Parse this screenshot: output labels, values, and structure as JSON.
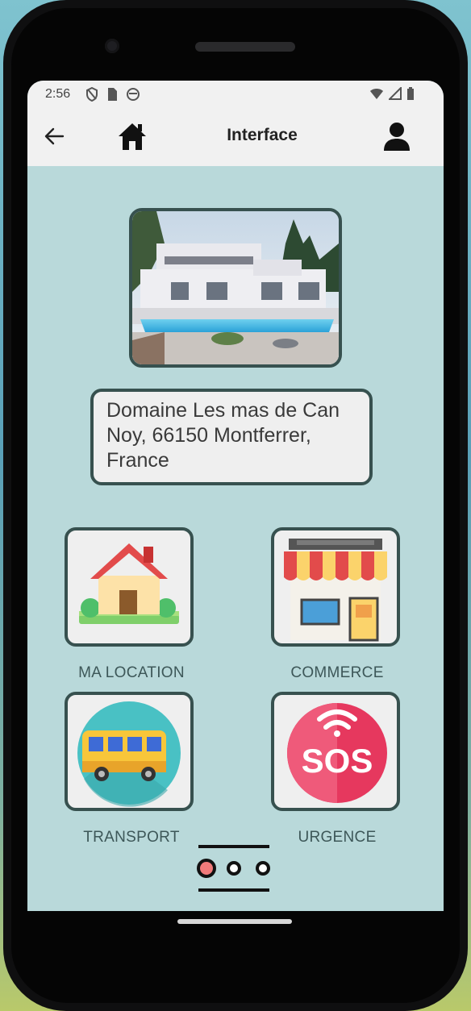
{
  "status_bar": {
    "time": "2:56"
  },
  "app_bar": {
    "title": "Interface"
  },
  "address": "Domaine Les mas de Can Noy, 66150 Montferrer, France",
  "tiles": [
    {
      "label": "MA LOCATION",
      "icon": "house-icon"
    },
    {
      "label": "COMMERCE",
      "icon": "shop-icon"
    },
    {
      "label": "TRANSPORT",
      "icon": "bus-icon"
    },
    {
      "label": "URGENCE",
      "icon": "sos-icon"
    }
  ],
  "pager": {
    "pages": 3,
    "active": 1
  },
  "colors": {
    "screen_bg": "#b9d9da",
    "border": "#37514f",
    "active_dot": "#f07a7a"
  }
}
